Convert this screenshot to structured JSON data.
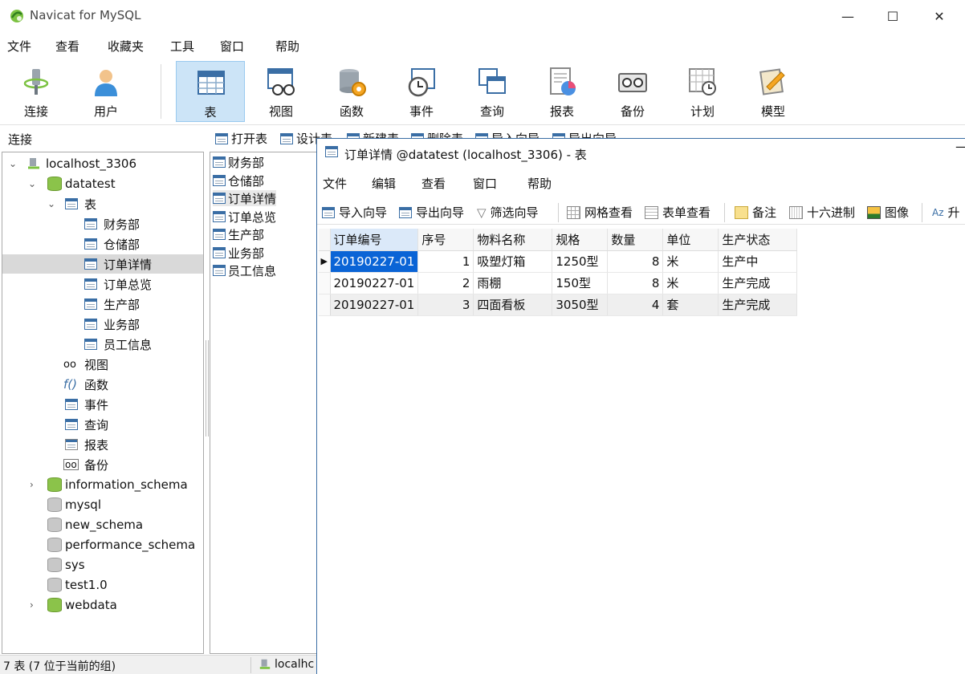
{
  "app": {
    "title": "Navicat for MySQL",
    "minimize": "—",
    "maximize": "☐",
    "close": "✕"
  },
  "menu": [
    "文件",
    "查看",
    "收藏夹",
    "工具",
    "窗口",
    "帮助"
  ],
  "toolbar": {
    "connect": "连接",
    "user": "用户",
    "table": "表",
    "view": "视图",
    "function": "函数",
    "event": "事件",
    "query": "查询",
    "report": "报表",
    "backup": "备份",
    "schedule": "计划",
    "model": "模型"
  },
  "connbar": {
    "label": "连接",
    "open_table": "打开表",
    "design_table": "设计表",
    "new_table": "新建表",
    "delete_table": "删除表",
    "import_wizard": "导入向导",
    "export_wizard": "导出向导"
  },
  "tree": {
    "connection": "localhost_3306",
    "database": "datatest",
    "tables_label": "表",
    "tables": [
      "财务部",
      "仓储部",
      "订单详情",
      "订单总览",
      "生产部",
      "业务部",
      "员工信息"
    ],
    "selected_table": "订单详情",
    "view": "视图",
    "function": "函数",
    "event": "事件",
    "query": "查询",
    "report": "报表",
    "backup": "备份",
    "other_dbs": [
      "information_schema",
      "mysql",
      "new_schema",
      "performance_schema",
      "sys",
      "test1.0",
      "webdata"
    ]
  },
  "objects": [
    "财务部",
    "仓储部",
    "订单详情",
    "订单总览",
    "生产部",
    "业务部",
    "员工信息"
  ],
  "status": {
    "left": "7 表 (7 位于当前的组)",
    "conn": "localhc"
  },
  "child": {
    "title": "订单详情 @datatest (localhost_3306) - 表",
    "minimize": "—",
    "menu": [
      "文件",
      "编辑",
      "查看",
      "窗口",
      "帮助"
    ],
    "tools": {
      "import": "导入向导",
      "export": "导出向导",
      "filter": "筛选向导",
      "grid_view": "网格查看",
      "form_view": "表单查看",
      "memo": "备注",
      "hex": "十六进制",
      "image": "图像",
      "sort": "升"
    },
    "columns": [
      "订单编号",
      "序号",
      "物料名称",
      "规格",
      "数量",
      "单位",
      "生产状态"
    ],
    "rows": [
      [
        "20190227-01",
        "1",
        "吸塑灯箱",
        "1250型",
        "8",
        "米",
        "生产中"
      ],
      [
        "20190227-01",
        "2",
        "雨棚",
        "150型",
        "8",
        "米",
        "生产完成"
      ],
      [
        "20190227-01",
        "3",
        "四面看板",
        "3050型",
        "4",
        "套",
        "生产完成"
      ]
    ]
  },
  "colors": {
    "selection_blue": "#0a64d6",
    "toolbar_active": "#cce4f7",
    "db_green": "#8bc34a"
  }
}
